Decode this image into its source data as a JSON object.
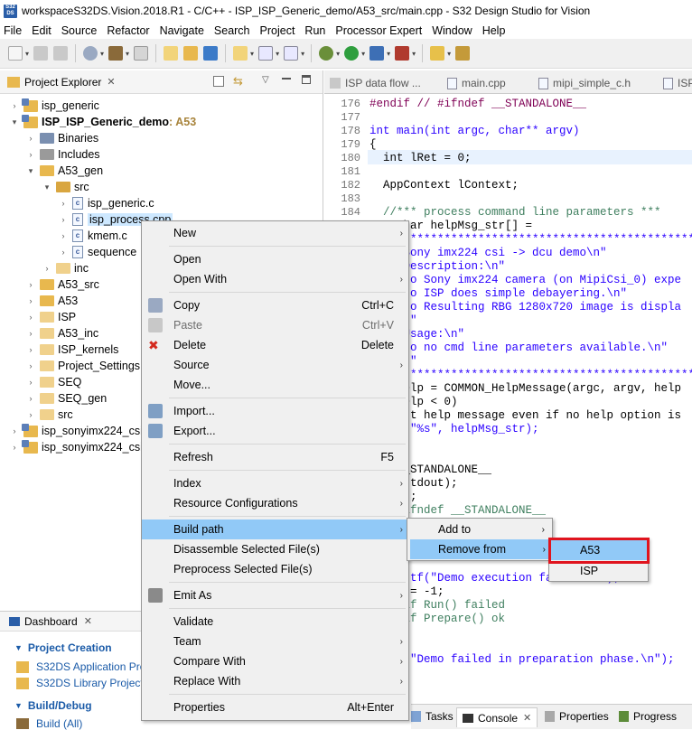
{
  "window": {
    "title": "workspaceS32DS.Vision.2018.R1 - C/C++ - ISP_ISP_Generic_demo/A53_src/main.cpp - S32 Design Studio for Vision",
    "app_icon_text": "S32\nDS"
  },
  "menubar": [
    "File",
    "Edit",
    "Source",
    "Refactor",
    "Navigate",
    "Search",
    "Project",
    "Run",
    "Processor Expert",
    "Window",
    "Help"
  ],
  "project_explorer": {
    "title": "Project Explorer",
    "tree": [
      {
        "label": "isp_generic",
        "type": "project",
        "depth": 0,
        "expanded": false
      },
      {
        "label": "ISP_ISP_Generic_demo",
        "suffix": ": A53",
        "type": "project",
        "depth": 0,
        "expanded": true,
        "bold": true
      },
      {
        "label": "Binaries",
        "type": "binaries",
        "depth": 1,
        "expanded": false
      },
      {
        "label": "Includes",
        "type": "includes",
        "depth": 1,
        "expanded": false
      },
      {
        "label": "A53_gen",
        "type": "folder",
        "depth": 1,
        "expanded": true
      },
      {
        "label": "src",
        "type": "srcfolder",
        "depth": 2,
        "expanded": true
      },
      {
        "label": "isp_generic.c",
        "type": "cfile",
        "depth": 3
      },
      {
        "label": "isp_process.cpp",
        "type": "cppfile",
        "depth": 3,
        "selected": true
      },
      {
        "label": "kmem.c",
        "type": "cfile",
        "depth": 3
      },
      {
        "label": "sequence",
        "type": "cfile",
        "depth": 3
      },
      {
        "label": "inc",
        "type": "folder",
        "depth": 2,
        "dim": true
      },
      {
        "label": "A53_src",
        "type": "folder",
        "depth": 1
      },
      {
        "label": "A53",
        "type": "folder",
        "depth": 1
      },
      {
        "label": "ISP",
        "type": "folder",
        "depth": 1,
        "dim": true
      },
      {
        "label": "A53_inc",
        "type": "folder",
        "depth": 1,
        "dim": true
      },
      {
        "label": "ISP_kernels",
        "type": "folder",
        "depth": 1,
        "dim": true
      },
      {
        "label": "Project_Settings",
        "type": "folder",
        "depth": 1,
        "dim": true
      },
      {
        "label": "SEQ",
        "type": "folder",
        "depth": 1,
        "dim": true
      },
      {
        "label": "SEQ_gen",
        "type": "folder",
        "depth": 1,
        "dim": true
      },
      {
        "label": "src",
        "type": "folder",
        "depth": 1,
        "dim": true
      },
      {
        "label": "isp_sonyimx224_csi_",
        "type": "project",
        "depth": 0,
        "expanded": false
      },
      {
        "label": "isp_sonyimx224_csi_",
        "type": "project",
        "depth": 0,
        "expanded": false
      }
    ]
  },
  "editor": {
    "tabs": [
      "ISP data flow ...",
      "main.cpp",
      "mipi_simple_c.h",
      "ISP"
    ],
    "line_numbers": [
      "176",
      "177",
      "178",
      "179",
      "180",
      "181",
      "182",
      "183",
      "184"
    ],
    "lines": [
      "#endif // #ifndef __STANDALONE__",
      "",
      "int main(int argc, char** argv)",
      "{",
      "  int lRet = 0;",
      "",
      "  AppContext lContext;",
      "",
      "  //*** process command line parameters ***",
      "  t char helpMsg_str[] =",
      "  \\n************************************************",
      "  ** Sony imx224 csi -> dcu demo\\n\"",
      "  ** Description:\\n\"",
      "  **  o Sony imx224 camera (on MipiCsi_0) expe",
      "  **  o ISP does simple debayering.\\n\"",
      "  **  o Resulting RBG 1280x720 image is displa",
      "  **\\n\"",
      "  ** Usage:\\n\"",
      "  **  o no cmd line parameters available.\\n\"",
      "  **\\n\"",
      "  ************************************************",
      "  dxHelp = COMMON_HelpMessage(argc, argv, help",
      "  dxHelp < 0)",
      "  print help message even if no help option is",
      "  ntf(\"%s\", helpMsg_str);",
      "",
      "",
      "  f __STANDALONE__",
      "  sh(stdout);",
      "  p(1);",
      "  // ifndef __STANDALONE__",
      "",
      "",
      "  Run(lContext) != 0)",
      "",
      "  printf(\"Demo execution failed.\\n\");",
      "  Ret = -1;",
      "  // if Run() failed",
      "  // if Prepare() ok",
      "",
      "",
      "  ntf(\"Demo failed in preparation phase.\\n\");"
    ]
  },
  "context_menu": {
    "items": [
      {
        "label": "New",
        "submenu": true
      },
      {
        "label": "Open"
      },
      {
        "label": "Open With",
        "submenu": true
      },
      {
        "label": "Copy",
        "accel": "Ctrl+C",
        "icon": "copy-icon"
      },
      {
        "label": "Paste",
        "accel": "Ctrl+V",
        "icon": "paste-icon",
        "disabled": true
      },
      {
        "label": "Delete",
        "accel": "Delete",
        "icon": "delete-icon"
      },
      {
        "label": "Source",
        "submenu": true
      },
      {
        "label": "Move..."
      },
      {
        "label": "Import...",
        "icon": "import-icon"
      },
      {
        "label": "Export...",
        "icon": "export-icon"
      },
      {
        "label": "Refresh",
        "accel": "F5"
      },
      {
        "label": "Index",
        "submenu": true
      },
      {
        "label": "Resource Configurations",
        "submenu": true
      },
      {
        "label": "Build path",
        "submenu": true,
        "highlight": true
      },
      {
        "label": "Disassemble Selected File(s)"
      },
      {
        "label": "Preprocess Selected File(s)"
      },
      {
        "label": "Emit As",
        "submenu": true,
        "icon": "emit-icon"
      },
      {
        "label": "Validate"
      },
      {
        "label": "Team",
        "submenu": true
      },
      {
        "label": "Compare With",
        "submenu": true
      },
      {
        "label": "Replace With",
        "submenu": true
      },
      {
        "label": "Properties",
        "accel": "Alt+Enter"
      }
    ],
    "build_path_submenu": [
      {
        "label": "Add to",
        "submenu": true
      },
      {
        "label": "Remove from",
        "submenu": true,
        "highlight": true
      }
    ],
    "remove_from_submenu": [
      {
        "label": "A53",
        "highlight": true
      },
      {
        "label": "ISP"
      }
    ]
  },
  "dashboard": {
    "title": "Dashboard",
    "sections": [
      {
        "title": "Project Creation",
        "items": [
          "S32DS Application Proj",
          "S32DS Library Project"
        ]
      },
      {
        "title": "Build/Debug",
        "items": [
          "Build  (All)"
        ]
      }
    ]
  },
  "bottom_tabs": [
    "Tasks",
    "Console",
    "Properties",
    "Progress"
  ],
  "colors": {
    "accent_highlight": "#91c9f7",
    "annotation_box": "#e0141e",
    "section_blue": "#1b5ba8"
  }
}
